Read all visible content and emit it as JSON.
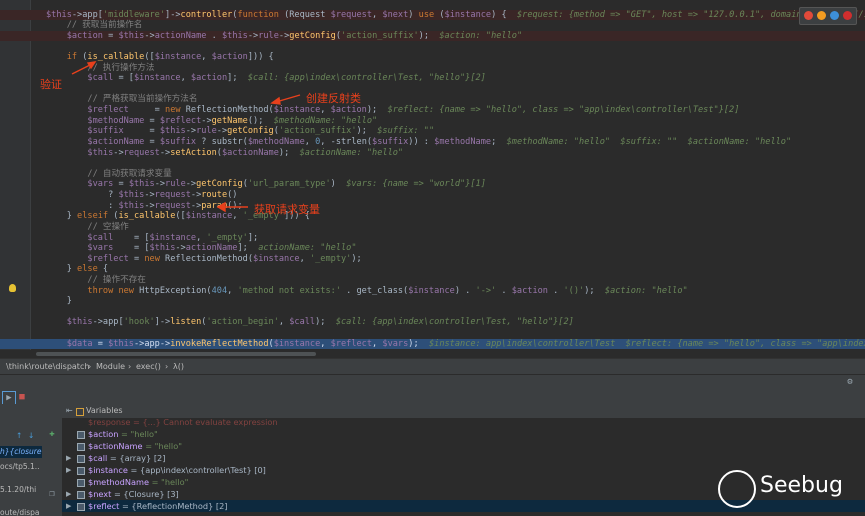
{
  "code": {
    "lines": [
      {
        "parts": [
          [
            "vr",
            "$this"
          ],
          [
            "",
            "->app["
          ],
          [
            "st",
            "'middleware'"
          ],
          [
            "",
            "]->"
          ],
          [
            "fn",
            "controller"
          ],
          [
            "",
            "("
          ],
          [
            "kw",
            "function"
          ],
          [
            "",
            " (Request "
          ],
          [
            "vr",
            "$request"
          ],
          [
            "",
            ", "
          ],
          [
            "vr",
            "$next"
          ],
          [
            "",
            ") "
          ],
          [
            "kw",
            "use"
          ],
          [
            "",
            " ("
          ],
          [
            "vr",
            "$instance"
          ],
          [
            "",
            ") {  "
          ],
          [
            "ann",
            "$request: {method => \"GET\", host => \"127.0.0.1\", domain => \"http://12"
          ]
        ]
      },
      {
        "parts": [
          [
            "cm",
            "    // 获取当前操作名"
          ]
        ]
      },
      {
        "parts": [
          [
            "",
            "    "
          ],
          [
            "vr",
            "$action"
          ],
          [
            "",
            " = "
          ],
          [
            "vr",
            "$this"
          ],
          [
            "",
            "->"
          ],
          [
            "vr",
            "actionName"
          ],
          [
            "",
            " . "
          ],
          [
            "vr",
            "$this"
          ],
          [
            "",
            "->"
          ],
          [
            "vr",
            "rule"
          ],
          [
            "",
            "->"
          ],
          [
            "fn",
            "getConfig"
          ],
          [
            "",
            "("
          ],
          [
            "st",
            "'action_suffix'"
          ],
          [
            "",
            ");  "
          ],
          [
            "ann",
            "$action: \"hello\""
          ]
        ]
      },
      {
        "parts": [
          [
            "",
            ""
          ]
        ]
      },
      {
        "parts": [
          [
            "",
            "    "
          ],
          [
            "kw",
            "if"
          ],
          [
            "",
            " ("
          ],
          [
            "fn",
            "is_callable"
          ],
          [
            "",
            "(["
          ],
          [
            "vr",
            "$instance"
          ],
          [
            "",
            ", "
          ],
          [
            "vr",
            "$action"
          ],
          [
            "",
            "])) {"
          ]
        ]
      },
      {
        "parts": [
          [
            "cm",
            "        // 执行操作方法"
          ]
        ]
      },
      {
        "parts": [
          [
            "",
            "        "
          ],
          [
            "vr",
            "$call"
          ],
          [
            "",
            " = ["
          ],
          [
            "vr",
            "$instance"
          ],
          [
            "",
            ", "
          ],
          [
            "vr",
            "$action"
          ],
          [
            "",
            "];  "
          ],
          [
            "ann",
            "$call: {app\\index\\controller\\Test, \"hello\"}[2]"
          ]
        ]
      },
      {
        "parts": [
          [
            "",
            ""
          ]
        ]
      },
      {
        "parts": [
          [
            "cm",
            "        // 严格获取当前操作方法名"
          ]
        ]
      },
      {
        "parts": [
          [
            "",
            "        "
          ],
          [
            "vr",
            "$reflect"
          ],
          [
            "",
            "     = "
          ],
          [
            "kw",
            "new"
          ],
          [
            "",
            " ReflectionMethod("
          ],
          [
            "vr",
            "$instance"
          ],
          [
            "",
            ", "
          ],
          [
            "vr",
            "$action"
          ],
          [
            "",
            ");  "
          ],
          [
            "ann",
            "$reflect: {name => \"hello\", class => \"app\\index\\controller\\Test\"}[2]"
          ]
        ]
      },
      {
        "parts": [
          [
            "",
            "        "
          ],
          [
            "vr",
            "$methodName"
          ],
          [
            "",
            " = "
          ],
          [
            "vr",
            "$reflect"
          ],
          [
            "",
            "->"
          ],
          [
            "fn",
            "getName"
          ],
          [
            "",
            "();  "
          ],
          [
            "ann",
            "$methodName: \"hello\""
          ]
        ]
      },
      {
        "parts": [
          [
            "",
            "        "
          ],
          [
            "vr",
            "$suffix"
          ],
          [
            "",
            "     = "
          ],
          [
            "vr",
            "$this"
          ],
          [
            "",
            "->"
          ],
          [
            "vr",
            "rule"
          ],
          [
            "",
            "->"
          ],
          [
            "fn",
            "getConfig"
          ],
          [
            "",
            "("
          ],
          [
            "st",
            "'action_suffix'"
          ],
          [
            "",
            ");  "
          ],
          [
            "ann",
            "$suffix: \"\""
          ]
        ]
      },
      {
        "parts": [
          [
            "",
            "        "
          ],
          [
            "vr",
            "$actionName"
          ],
          [
            "",
            " = "
          ],
          [
            "vr",
            "$suffix"
          ],
          [
            "",
            " ? substr("
          ],
          [
            "vr",
            "$methodName"
          ],
          [
            "",
            ", "
          ],
          [
            "nu",
            "0"
          ],
          [
            "",
            ", -strlen("
          ],
          [
            "vr",
            "$suffix"
          ],
          [
            "",
            ")) : "
          ],
          [
            "vr",
            "$methodName"
          ],
          [
            "",
            ";  "
          ],
          [
            "ann",
            "$methodName: \"hello\"  $suffix: \"\"  $actionName: \"hello\""
          ]
        ]
      },
      {
        "parts": [
          [
            "",
            "        "
          ],
          [
            "vr",
            "$this"
          ],
          [
            "",
            "->"
          ],
          [
            "vr",
            "request"
          ],
          [
            "",
            "->"
          ],
          [
            "fn",
            "setAction"
          ],
          [
            "",
            "("
          ],
          [
            "vr",
            "$actionName"
          ],
          [
            "",
            ");  "
          ],
          [
            "ann",
            "$actionName: \"hello\""
          ]
        ]
      },
      {
        "parts": [
          [
            "",
            ""
          ]
        ]
      },
      {
        "parts": [
          [
            "cm",
            "        // 自动获取请求变量"
          ]
        ]
      },
      {
        "parts": [
          [
            "",
            "        "
          ],
          [
            "vr",
            "$vars"
          ],
          [
            "",
            " = "
          ],
          [
            "vr",
            "$this"
          ],
          [
            "",
            "->"
          ],
          [
            "vr",
            "rule"
          ],
          [
            "",
            "->"
          ],
          [
            "fn",
            "getConfig"
          ],
          [
            "",
            "("
          ],
          [
            "st",
            "'url_param_type'"
          ],
          [
            "",
            ")  "
          ],
          [
            "ann",
            "$vars: {name => \"world\"}[1]"
          ]
        ]
      },
      {
        "parts": [
          [
            "",
            "            ? "
          ],
          [
            "vr",
            "$this"
          ],
          [
            "",
            "->"
          ],
          [
            "vr",
            "request"
          ],
          [
            "",
            "->"
          ],
          [
            "fn",
            "route"
          ],
          [
            "",
            "()"
          ]
        ]
      },
      {
        "parts": [
          [
            "",
            "            : "
          ],
          [
            "vr",
            "$this"
          ],
          [
            "",
            "->"
          ],
          [
            "vr",
            "request"
          ],
          [
            "",
            "->"
          ],
          [
            "fn",
            "param"
          ],
          [
            "",
            "();"
          ]
        ]
      },
      {
        "parts": [
          [
            "",
            "    } "
          ],
          [
            "kw",
            "elseif"
          ],
          [
            "",
            " ("
          ],
          [
            "fn",
            "is_callable"
          ],
          [
            "",
            "(["
          ],
          [
            "vr",
            "$instance"
          ],
          [
            "",
            ", "
          ],
          [
            "st",
            "'_empty'"
          ],
          [
            "",
            "])) {"
          ]
        ]
      },
      {
        "parts": [
          [
            "cm",
            "        // 空操作"
          ]
        ]
      },
      {
        "parts": [
          [
            "",
            "        "
          ],
          [
            "vr",
            "$call"
          ],
          [
            "",
            "    = ["
          ],
          [
            "vr",
            "$instance"
          ],
          [
            "",
            ", "
          ],
          [
            "st",
            "'_empty'"
          ],
          [
            "",
            "];"
          ]
        ]
      },
      {
        "parts": [
          [
            "",
            "        "
          ],
          [
            "vr",
            "$vars"
          ],
          [
            "",
            "    = ["
          ],
          [
            "vr",
            "$this"
          ],
          [
            "",
            "->"
          ],
          [
            "vr",
            "actionName"
          ],
          [
            "",
            "];  "
          ],
          [
            "ann",
            "actionName: \"hello\""
          ]
        ]
      },
      {
        "parts": [
          [
            "",
            "        "
          ],
          [
            "vr",
            "$reflect"
          ],
          [
            "",
            " = "
          ],
          [
            "kw",
            "new"
          ],
          [
            "",
            " ReflectionMethod("
          ],
          [
            "vr",
            "$instance"
          ],
          [
            "",
            ", "
          ],
          [
            "st",
            "'_empty'"
          ],
          [
            "",
            ");"
          ]
        ]
      },
      {
        "parts": [
          [
            "",
            "    } "
          ],
          [
            "kw",
            "else"
          ],
          [
            "",
            " {"
          ]
        ]
      },
      {
        "parts": [
          [
            "cm",
            "        // 操作不存在"
          ]
        ]
      },
      {
        "parts": [
          [
            "",
            "        "
          ],
          [
            "kw",
            "throw new"
          ],
          [
            "",
            " HttpException("
          ],
          [
            "nu",
            "404"
          ],
          [
            "",
            ", "
          ],
          [
            "st",
            "'method not exists:'"
          ],
          [
            "",
            " . get_class("
          ],
          [
            "vr",
            "$instance"
          ],
          [
            "",
            ") . "
          ],
          [
            "st",
            "'->'"
          ],
          [
            "",
            " . "
          ],
          [
            "vr",
            "$action"
          ],
          [
            "",
            " . "
          ],
          [
            "st",
            "'()'"
          ],
          [
            "",
            ");  "
          ],
          [
            "ann",
            "$action: \"hello\""
          ]
        ]
      },
      {
        "parts": [
          [
            "",
            "    }"
          ]
        ]
      },
      {
        "parts": [
          [
            "",
            ""
          ]
        ]
      },
      {
        "parts": [
          [
            "",
            "    "
          ],
          [
            "vr",
            "$this"
          ],
          [
            "",
            "->app["
          ],
          [
            "st",
            "'hook'"
          ],
          [
            "",
            "]->"
          ],
          [
            "fn",
            "listen"
          ],
          [
            "",
            "("
          ],
          [
            "st",
            "'action_begin'"
          ],
          [
            "",
            ", "
          ],
          [
            "vr",
            "$call"
          ],
          [
            "",
            ");  "
          ],
          [
            "ann",
            "$call: {app\\index\\controller\\Test, \"hello\"}[2]"
          ]
        ]
      },
      {
        "parts": [
          [
            "",
            ""
          ]
        ]
      },
      {
        "parts": [
          [
            "",
            "    "
          ],
          [
            "vr",
            "$data"
          ],
          [
            "",
            " = "
          ],
          [
            "vr",
            "$this"
          ],
          [
            "",
            "->app->"
          ],
          [
            "fn",
            "invokeReflectMethod"
          ],
          [
            "",
            "("
          ],
          [
            "vr",
            "$instance"
          ],
          [
            "",
            ", "
          ],
          [
            "vr",
            "$reflect"
          ],
          [
            "",
            ", "
          ],
          [
            "vr",
            "$vars"
          ],
          [
            "",
            ");  "
          ],
          [
            "ann",
            "$instance: app\\index\\controller\\Test  $reflect: {name => \"hello\", class => \"app\\index\\cont"
          ]
        ]
      }
    ]
  },
  "annotations": {
    "verify": "验证",
    "create_reflection": "创建反射类",
    "get_request_vars": "获取请求变量"
  },
  "breadcrumb": [
    "\\think\\route\\dispatch",
    "Module",
    "exec()",
    "λ()"
  ],
  "frames": [
    "h}{closure",
    "ocs/tp5.1..",
    "5.1.20/thi",
    "oute/dispa"
  ],
  "variables": {
    "title": "Variables",
    "clipped_row": "$response = {...}   Cannot evaluate expression",
    "rows": [
      {
        "name": "$action",
        "value": "= \"hello\"",
        "expand": false
      },
      {
        "name": "$actionName",
        "value": "= \"hello\"",
        "expand": false
      },
      {
        "name": "$call",
        "value": "= {array} [2]",
        "expand": true
      },
      {
        "name": "$instance",
        "value": "= {app\\index\\controller\\Test} [0]",
        "expand": true
      },
      {
        "name": "$methodName",
        "value": "= \"hello\"",
        "expand": false
      },
      {
        "name": "$next",
        "value": "= {Closure} [3]",
        "expand": true
      },
      {
        "name": "$reflect",
        "value": "= {ReflectionMethod} [2]",
        "expand": true
      }
    ]
  },
  "watermark": "Seebug",
  "colors": {
    "accent": "#e8401c",
    "exec_line": "#2d4f79",
    "selection": "#0d293e"
  }
}
